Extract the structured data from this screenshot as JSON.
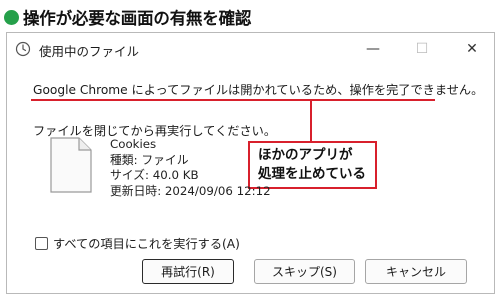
{
  "heading": {
    "text": "操作が必要な画面の有無を確認"
  },
  "dialog": {
    "title": "使用中のファイル",
    "message": "Google Chrome によってファイルは開かれているため、操作を完了できません。",
    "instruction": "ファイルを閉じてから再実行してください。",
    "callout": {
      "line1": "ほかのアプリが",
      "line2": "処理を止めている"
    },
    "file": {
      "name": "Cookies",
      "type": "種類: ファイル",
      "size": "サイズ: 40.0 KB",
      "modified": "更新日時: 2024/09/06 12:12"
    },
    "checkbox": {
      "label": "すべての項目にこれを実行する(A)",
      "checked": false
    },
    "buttons": {
      "retry": "再試行(R)",
      "skip": "スキップ(S)",
      "cancel": "キャンセル"
    },
    "window_controls": {
      "minimize": "—",
      "maximize": "☐",
      "close": "✕"
    }
  },
  "colors": {
    "accent_dot": "#25a04a",
    "highlight": "#d8202c"
  }
}
